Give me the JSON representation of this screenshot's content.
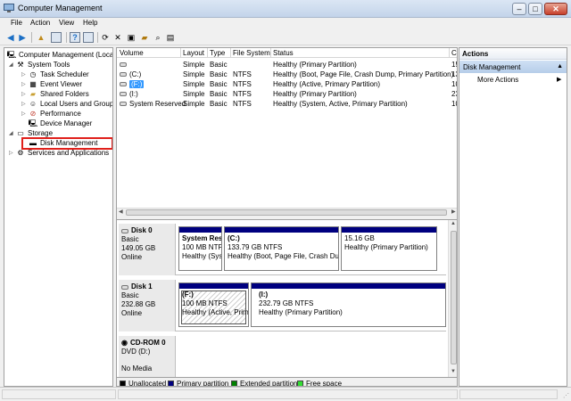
{
  "window": {
    "title": "Computer Management"
  },
  "menu": [
    "File",
    "Action",
    "View",
    "Help"
  ],
  "tree": {
    "root": "Computer Management (Local)",
    "system_tools": "System Tools",
    "task_scheduler": "Task Scheduler",
    "event_viewer": "Event Viewer",
    "shared_folders": "Shared Folders",
    "local_users": "Local Users and Groups",
    "performance": "Performance",
    "device_manager": "Device Manager",
    "storage": "Storage",
    "disk_management": "Disk Management",
    "services": "Services and Applications"
  },
  "volumes": {
    "headers": [
      "Volume",
      "Layout",
      "Type",
      "File System",
      "Status",
      "C"
    ],
    "rows": [
      {
        "volume": "",
        "layout": "Simple",
        "type": "Basic",
        "fs": "",
        "status": "Healthy (Primary Partition)",
        "cap": "15"
      },
      {
        "volume": "(C:)",
        "layout": "Simple",
        "type": "Basic",
        "fs": "NTFS",
        "status": "Healthy (Boot, Page File, Crash Dump, Primary Partition)",
        "cap": "13"
      },
      {
        "volume": "(F:)",
        "layout": "Simple",
        "type": "Basic",
        "fs": "NTFS",
        "status": "Healthy (Active, Primary Partition)",
        "cap": "10"
      },
      {
        "volume": "(I:)",
        "layout": "Simple",
        "type": "Basic",
        "fs": "NTFS",
        "status": "Healthy (Primary Partition)",
        "cap": "23"
      },
      {
        "volume": "System Reserved",
        "layout": "Simple",
        "type": "Basic",
        "fs": "NTFS",
        "status": "Healthy (System, Active, Primary Partition)",
        "cap": "10"
      }
    ]
  },
  "disks": {
    "disk0": {
      "name": "Disk 0",
      "type": "Basic",
      "size": "149.05 GB",
      "state": "Online",
      "parts": [
        {
          "name": "System Res",
          "size": "100 MB NTF",
          "status": "Healthy (Sys"
        },
        {
          "name": "(C:)",
          "size": "133.79 GB NTFS",
          "status": "Healthy (Boot, Page File, Crash Dum"
        },
        {
          "name": "",
          "size": "15.16 GB",
          "status": "Healthy (Primary Partition)"
        }
      ]
    },
    "disk1": {
      "name": "Disk 1",
      "type": "Basic",
      "size": "232.88 GB",
      "state": "Online",
      "parts": [
        {
          "name": "(F:)",
          "size": "100 MB NTFS",
          "status": "Healthy (Active, Prim"
        },
        {
          "name": "(I:)",
          "size": "232.79 GB NTFS",
          "status": "Healthy (Primary Partition)"
        }
      ]
    },
    "cdrom": {
      "name": "CD-ROM 0",
      "type": "DVD (D:)",
      "state": "No Media"
    }
  },
  "legend": {
    "unallocated": "Unallocated",
    "primary": "Primary partition",
    "extended": "Extended partition",
    "free": "Free space"
  },
  "colors": {
    "unallocated": "#000000",
    "primary": "#00007f",
    "extended": "#008000",
    "free": "#33dd33",
    "selection": "#3399ff",
    "highlight_box": "#e0201b"
  },
  "actions": {
    "header": "Actions",
    "group": "Disk Management",
    "more": "More Actions"
  }
}
